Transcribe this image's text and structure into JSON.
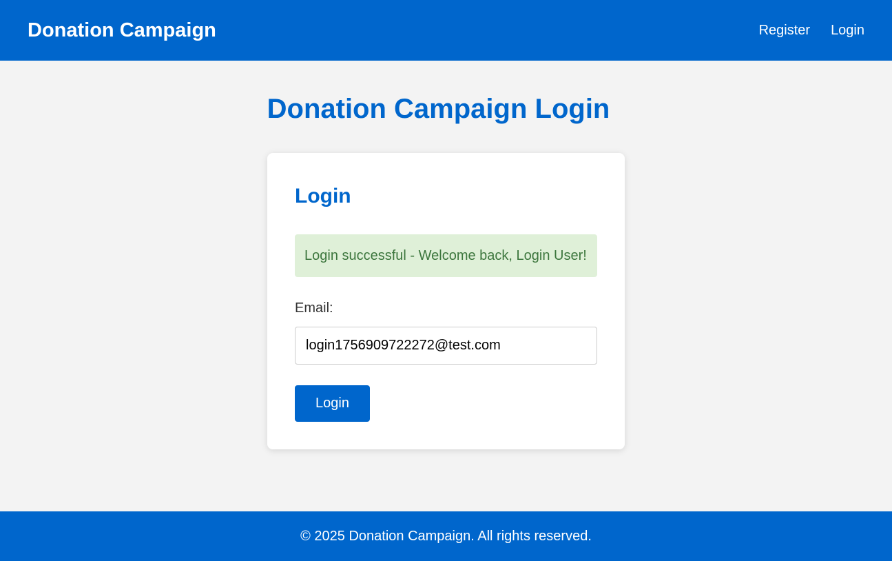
{
  "header": {
    "brand": "Donation Campaign",
    "nav": {
      "register": "Register",
      "login": "Login"
    }
  },
  "main": {
    "page_title": "Donation Campaign Login",
    "card": {
      "title": "Login",
      "alert": "Login successful - Welcome back, Login User!",
      "email_label": "Email:",
      "email_value": "login1756909722272@test.com",
      "submit_label": "Login"
    }
  },
  "footer": {
    "text": "© 2025 Donation Campaign. All rights reserved."
  },
  "colors": {
    "primary": "#0066cc",
    "background": "#f3f3f3",
    "success_bg": "#dff0d8",
    "success_text": "#3c763d"
  }
}
